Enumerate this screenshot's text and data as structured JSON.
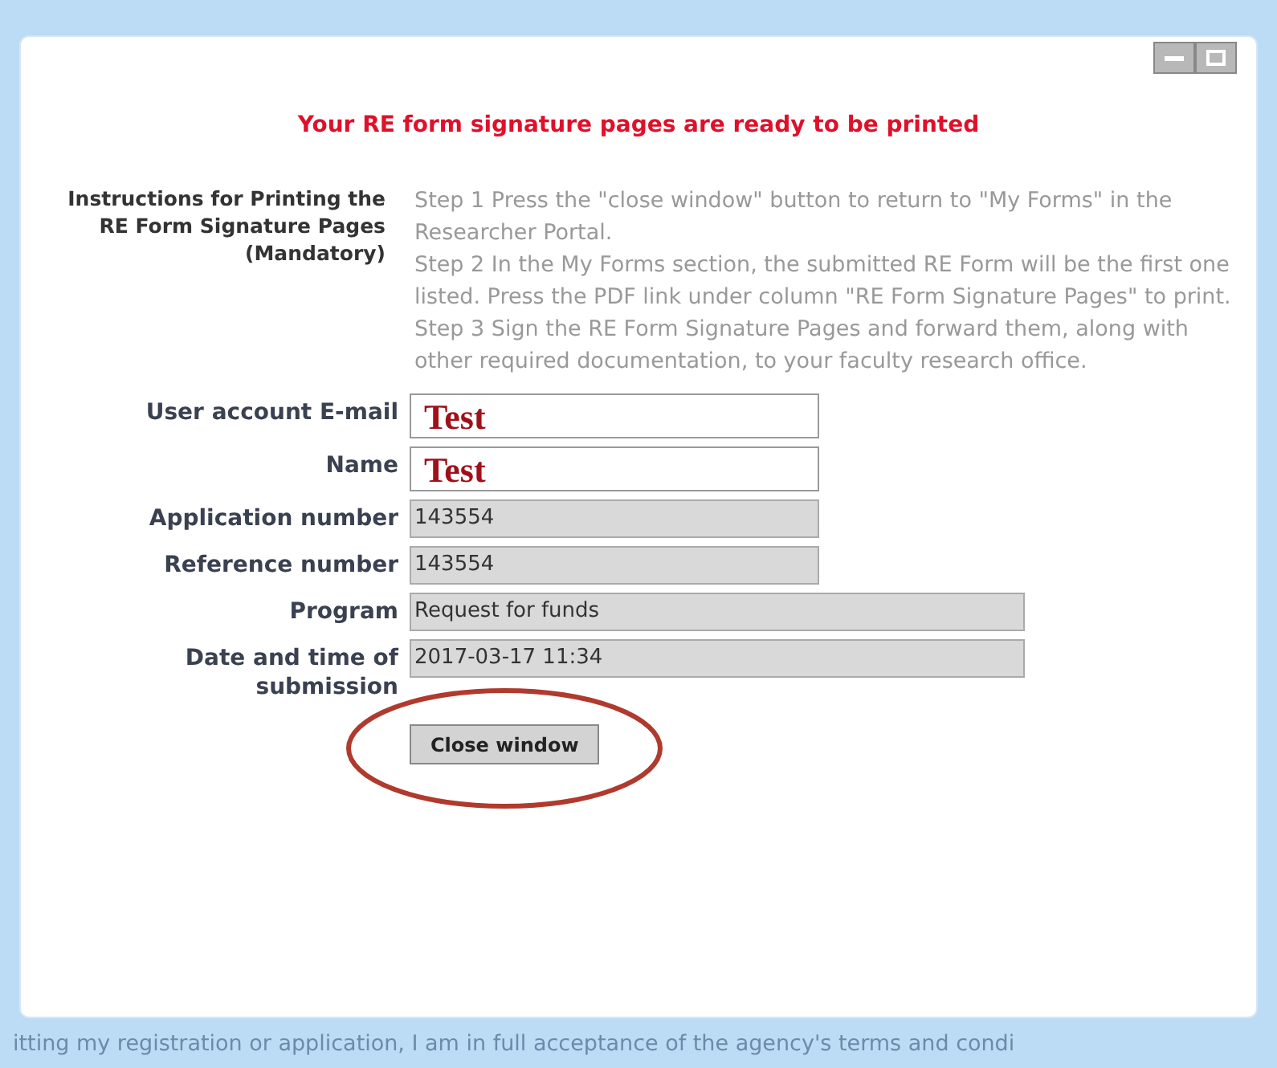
{
  "heading": "Your RE form signature pages are ready to be printed",
  "instructions": {
    "label": "Instructions for Printing the RE Form Signature Pages (Mandatory)",
    "steps": [
      "Step 1 Press the \"close window\" button to return to \"My Forms\" in the Researcher Portal.",
      "Step 2 In the My Forms section, the submitted RE Form will be the first one listed. Press the PDF link under column \"RE Form Signature Pages\" to print.",
      "Step 3 Sign the RE Form Signature Pages and forward them, along with other required documentation, to your faculty research office."
    ]
  },
  "fields": [
    {
      "label": "User account E-mail",
      "value": "Test",
      "kind": "editable",
      "wide": false
    },
    {
      "label": "Name",
      "value": "Test",
      "kind": "editable",
      "wide": false
    },
    {
      "label": "Application number",
      "value": "143554",
      "kind": "readonly",
      "wide": false
    },
    {
      "label": "Reference number",
      "value": "143554",
      "kind": "readonly",
      "wide": false
    },
    {
      "label": "Program",
      "value": "Request for funds",
      "kind": "readonly",
      "wide": true
    },
    {
      "label": "Date and time of submission",
      "value": "2017-03-17 11:34",
      "kind": "readonly",
      "wide": true
    }
  ],
  "close_button": "Close window",
  "footer_text": "itting my registration or application, I am in full acceptance of the agency's terms and condi"
}
